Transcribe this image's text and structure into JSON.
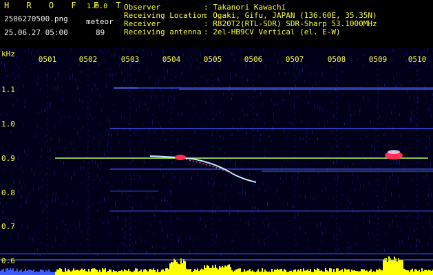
{
  "header": {
    "app_title": "H R O F F T",
    "version": "1.0.0",
    "filename": "2506270500.png",
    "datetime": "25.06.27 05:00",
    "meteor_label": "meteor",
    "meteor_count": "89",
    "info_labels": [
      "Observer",
      "Receiving Location",
      "Receiver",
      "Receiving antenna"
    ],
    "info_values": [
      ": Takanori Kawachi",
      ": Ogaki, Gifu, JAPAN (136.60E, 35.35N)",
      ": R820T2(RTL-SDR) SDR-Sharp 53.1000MHz",
      ": 2el-HB9CV Vertical (el. E-W)"
    ]
  },
  "axes": {
    "y_unit": "kHz",
    "x_ticks": [
      "0501",
      "0502",
      "0503",
      "0504",
      "0505",
      "0506",
      "0507",
      "0508",
      "0509",
      "0510"
    ],
    "y_ticks": [
      "1.1",
      "1.0",
      "0.9",
      "0.8",
      "0.7",
      "0.6"
    ]
  },
  "colors": {
    "background": "#000000",
    "label_yellow": "#ffff3a",
    "label_white": "#f2f2f2",
    "baseline_green": "#b8ff6a",
    "echo_red": "#ff3050",
    "echo_white": "#f0e0ff",
    "noise_blue": "#2a3cff",
    "amplitude_yellow": "#ffff00",
    "amplitude_blue": "#3a5cff"
  }
}
